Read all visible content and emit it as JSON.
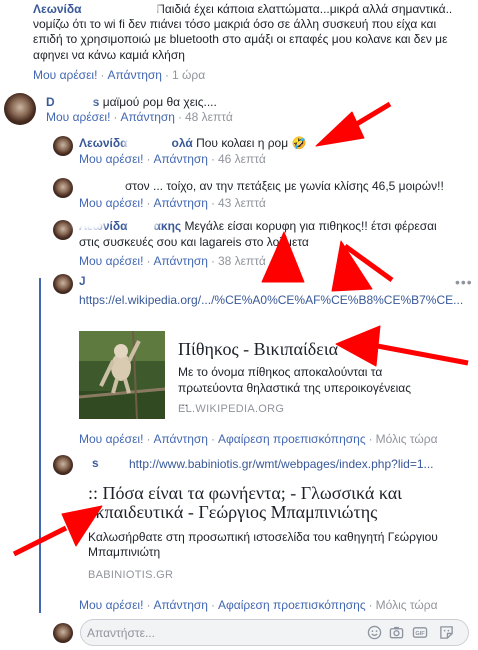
{
  "comment1": {
    "author": "Λεωνίδα",
    "line1": "Παιδιά έχει κάποια ελαττώματα...μικρά αλλά σημαντικά..",
    "line2": "νομίζω ότι το wi fi δεν πιάνει τόσο μακριά όσο σε άλλη συσκευή που είχα και",
    "line3": "επιδή το χρησιμοποιώ με bluetooth στο αμάξι οι επαφές μου κολανε και δεν με",
    "line4": "αφηνει να κάνω καμιά κλήση",
    "like": "Μου αρέσει!",
    "reply": "Απάντηση",
    "time": "1 ώρα"
  },
  "comment2": {
    "author": "D",
    "author2": "s",
    "text": "μαϊμού ρομ θα χεις....",
    "like": "Μου αρέσει!",
    "reply": "Απάντηση",
    "time": "48 λεπτά"
  },
  "reply1": {
    "author": "Λεωνίδα",
    "author2": "ολά",
    "text": "Που κολαει η ρομ",
    "emoji": "🤣",
    "like": "Μου αρέσει!",
    "reply": "Απάντηση",
    "time": "46 λεπτά"
  },
  "reply2": {
    "text": "στον ... τοίχο, αν την πετάξεις με γωνία κλίσης 46,5 μοιρών!!",
    "like": "Μου αρέσει!",
    "reply": "Απάντηση",
    "time": "43 λεπτά"
  },
  "reply3": {
    "author": "Λεωνίδα",
    "author2": "ακης",
    "line1": "Μεγάλε είσαι κορυφη για πιθηκος!! έτσι φέρεσαι",
    "line2": "στις συσκευές σου και lagareis στο λολμετα",
    "like": "Μου αρέσει!",
    "reply": "Απάντηση",
    "time": "38 λεπτά"
  },
  "reply4": {
    "author": "J",
    "url": "https://el.wikipedia.org/.../%CE%A0%CE%AF%CE%B8%CE%B7%CE...",
    "card_title": "Πίθηκος - Βικιπαίδεια",
    "card_desc1": "Με το όνομα πίθηκος αποκαλούνται τα",
    "card_desc2": "πρωτεύοντα θηλαστικά της υπεροικογένειας",
    "card_desc3": "...",
    "card_domain": "EL.WIKIPEDIA.ORG",
    "like": "Μου αρέσει!",
    "reply": "Απάντηση",
    "remove": "Αφαίρεση προεπισκόπησης",
    "time": "Μόλις τώρα"
  },
  "reply5": {
    "author": "s",
    "url": "http://www.babiniotis.gr/wmt/webpages/index.php?lid=1...",
    "card_title1": ":: Πόσα είναι τα φωνήεντα; - Γλωσσικά και",
    "card_title2": "εκπαιδευτικά - Γεώργιος Μπαμπινιώτης",
    "card_desc1": "Καλωσήρθατε στη προσωπική ιστοσελίδα του καθηγητή Γεώργιου",
    "card_desc2": "Μπαμπινιώτη",
    "card_domain": "BABINIOTIS.GR",
    "like": "Μου αρέσει!",
    "reply": "Απάντηση",
    "remove": "Αφαίρεση προεπισκόπησης",
    "time": "Μόλις τώρα"
  },
  "composer": {
    "placeholder": "Απαντήστε...",
    "icons": [
      "emoji-icon",
      "camera-icon",
      "gif-icon",
      "sticker-icon"
    ]
  },
  "colors": {
    "link": "#385898",
    "meta": "#90949c",
    "action": "#4267b2",
    "arrow": "#ff0000",
    "thread": "#4267b2"
  }
}
